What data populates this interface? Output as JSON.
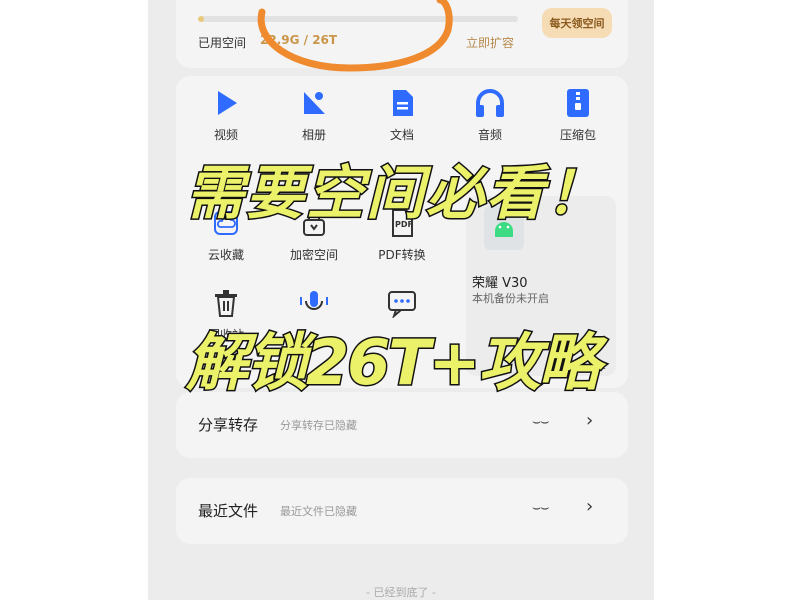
{
  "storage": {
    "used_label": "已用空间",
    "used_value": "22.9G / 26T",
    "used_fraction": 0.02,
    "expand_link": "立即扩容",
    "daily_button": "每天领空间"
  },
  "tools": [
    {
      "label": "视频",
      "icon": "play-icon"
    },
    {
      "label": "相册",
      "icon": "photo-icon"
    },
    {
      "label": "文档",
      "icon": "document-icon"
    },
    {
      "label": "音频",
      "icon": "headphones-icon"
    },
    {
      "label": "压缩包",
      "icon": "zip-icon"
    },
    {
      "label": "云收藏",
      "icon": "cloud-icon"
    },
    {
      "label": "加密空间",
      "icon": "lock-icon"
    },
    {
      "label": "PDF转换",
      "icon": "pdf-icon"
    },
    {
      "label": "回收站",
      "icon": "trash-icon"
    },
    {
      "label": "",
      "icon": "mic-icon"
    },
    {
      "label": "",
      "icon": "message-icon"
    }
  ],
  "backup": {
    "device_name": "荣耀 V30",
    "status": "本机备份未开启"
  },
  "share_row": {
    "title": "分享转存",
    "subtitle": "分享转存已隐藏"
  },
  "recent_row": {
    "title": "最近文件",
    "subtitle": "最近文件已隐藏"
  },
  "footer": "- 已经到底了 -",
  "overlay": {
    "headline": "需要空间必看！",
    "subheadline": "解锁26T+攻略"
  },
  "colors": {
    "accent_blue": "#2f6bff",
    "gold": "#c9964a",
    "overlay_yellow": "#ecf16a",
    "annotation_orange": "#f08a2e"
  }
}
